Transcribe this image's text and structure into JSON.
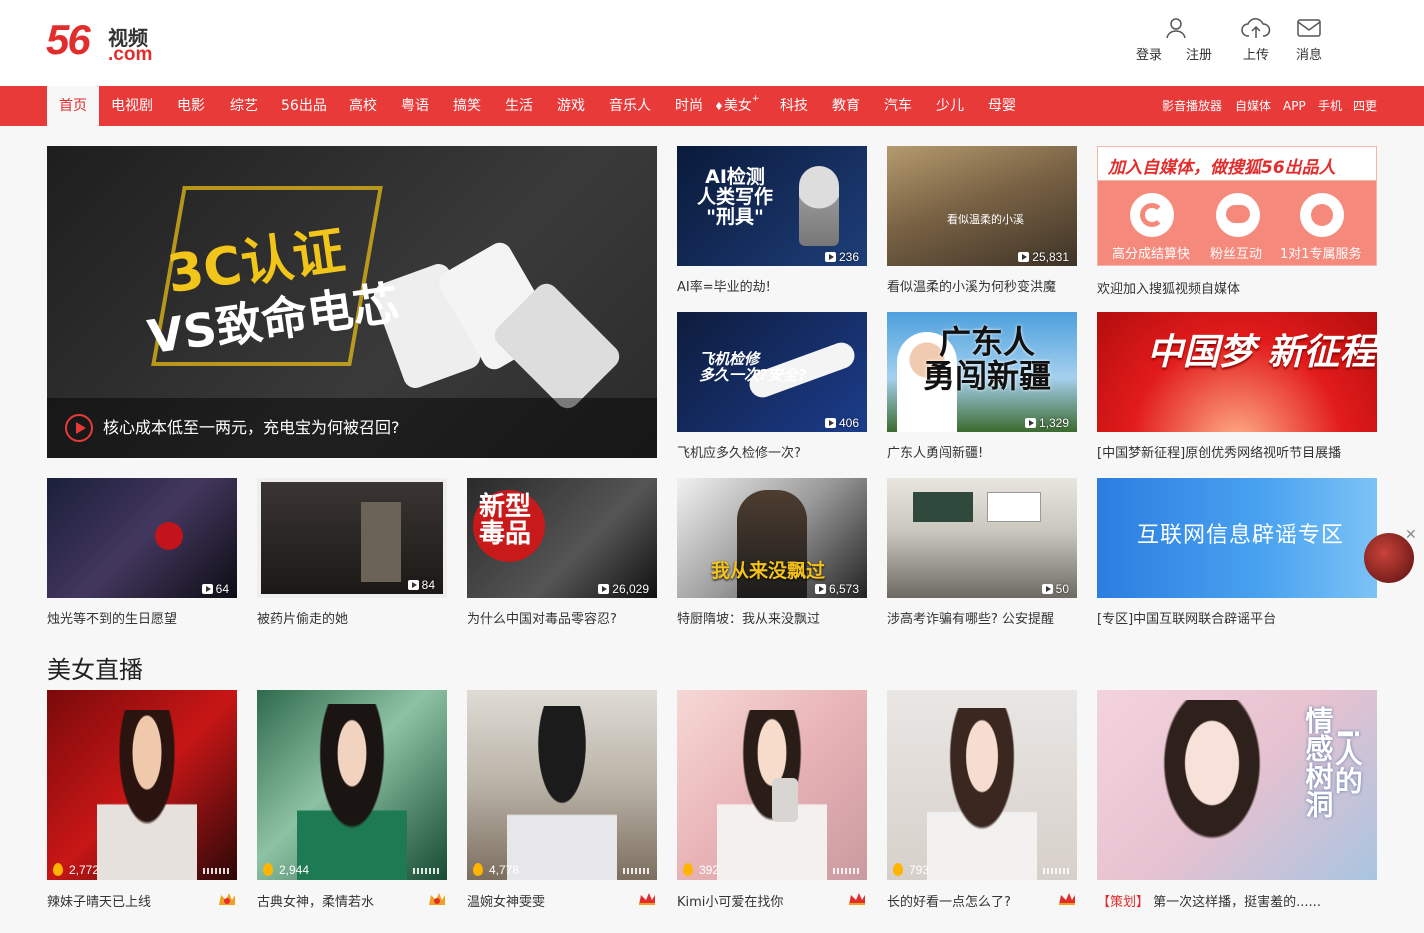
{
  "header": {
    "logo_number": "56",
    "logo_cn": "视频",
    "logo_com": ".com",
    "login": "登录",
    "register": "注册",
    "upload": "上传",
    "messages": "消息"
  },
  "nav": {
    "items": [
      "首页",
      "电视剧",
      "电影",
      "综艺",
      "56出品",
      "高校",
      "粤语",
      "搞笑",
      "生活",
      "游戏",
      "音乐人",
      "时尚",
      "美女",
      "科技",
      "教育",
      "汽车",
      "少儿",
      "母婴"
    ],
    "beauty_sup": "+",
    "right": [
      "影音播放器",
      "自媒体",
      "APP",
      "手机",
      "四更"
    ]
  },
  "featured": {
    "overlay_line1": "3C认证",
    "overlay_line2": "VS致命电芯",
    "title": "核心成本低至一两元，充电宝为何被召回?"
  },
  "grid_top": [
    {
      "overlay": "AI检测\n人类写作\n\"刑具\"",
      "count": "236",
      "caption": "AI率=毕业的劫!"
    },
    {
      "overlay": "看似温柔的小溪",
      "count": "25,831",
      "caption": "看似温柔的小溪为何秒变洪魔"
    },
    {
      "overlay": "飞机检修\n多久一次?安全?",
      "count": "406",
      "caption": "飞机应多久检修一次?"
    },
    {
      "overlay": "广东人\n勇闯新疆",
      "count": "1,329",
      "caption": "广东人勇闯新疆!"
    }
  ],
  "promo": {
    "heading": "加入自媒体，做搜狐56出品人",
    "features": [
      "高分成结算快",
      "粉丝互动",
      "1对1专属服务"
    ],
    "caption": "欢迎加入搜狐视频自媒体"
  },
  "china_dream": {
    "overlay": "中国梦 新征程",
    "caption": "[中国梦新征程]原创优秀网络视听节目展播"
  },
  "grid_row2": [
    {
      "count": "64",
      "caption": "烛光等不到的生日愿望"
    },
    {
      "count": "84",
      "caption": "被药片偷走的她"
    },
    {
      "overlay": "新型\n毒品",
      "count": "26,029",
      "caption": "为什么中国对毒品零容忍?"
    },
    {
      "overlay": "我从来没飘过",
      "count": "6,573",
      "caption": "特厨隋坡：我从来没飘过"
    },
    {
      "count": "50",
      "caption": "涉高考诈骗有哪些? 公安提醒"
    }
  ],
  "rumor": {
    "overlay": "互联网信息辟谣专区",
    "caption": "[专区]中国互联网联合辟谣平台"
  },
  "live_section": {
    "title": "美女直播",
    "items": [
      {
        "count": "2,772",
        "caption": "辣妹子晴天已上线"
      },
      {
        "count": "2,944",
        "caption": "古典女神，柔情若水"
      },
      {
        "count": "4,778",
        "caption": "温婉女神雯雯"
      },
      {
        "count": "392",
        "caption": "Kimi小可爱在找你"
      },
      {
        "count": "793",
        "caption": "长的好看一点怎么了?"
      }
    ],
    "last": {
      "overlay": "i人的\n情感树洞",
      "tag": "【策划】",
      "caption": "第一次这样播，挺害羞的......"
    }
  },
  "colors": {
    "brand_red": "#e93a3a",
    "logo_red": "#e22d2d"
  }
}
